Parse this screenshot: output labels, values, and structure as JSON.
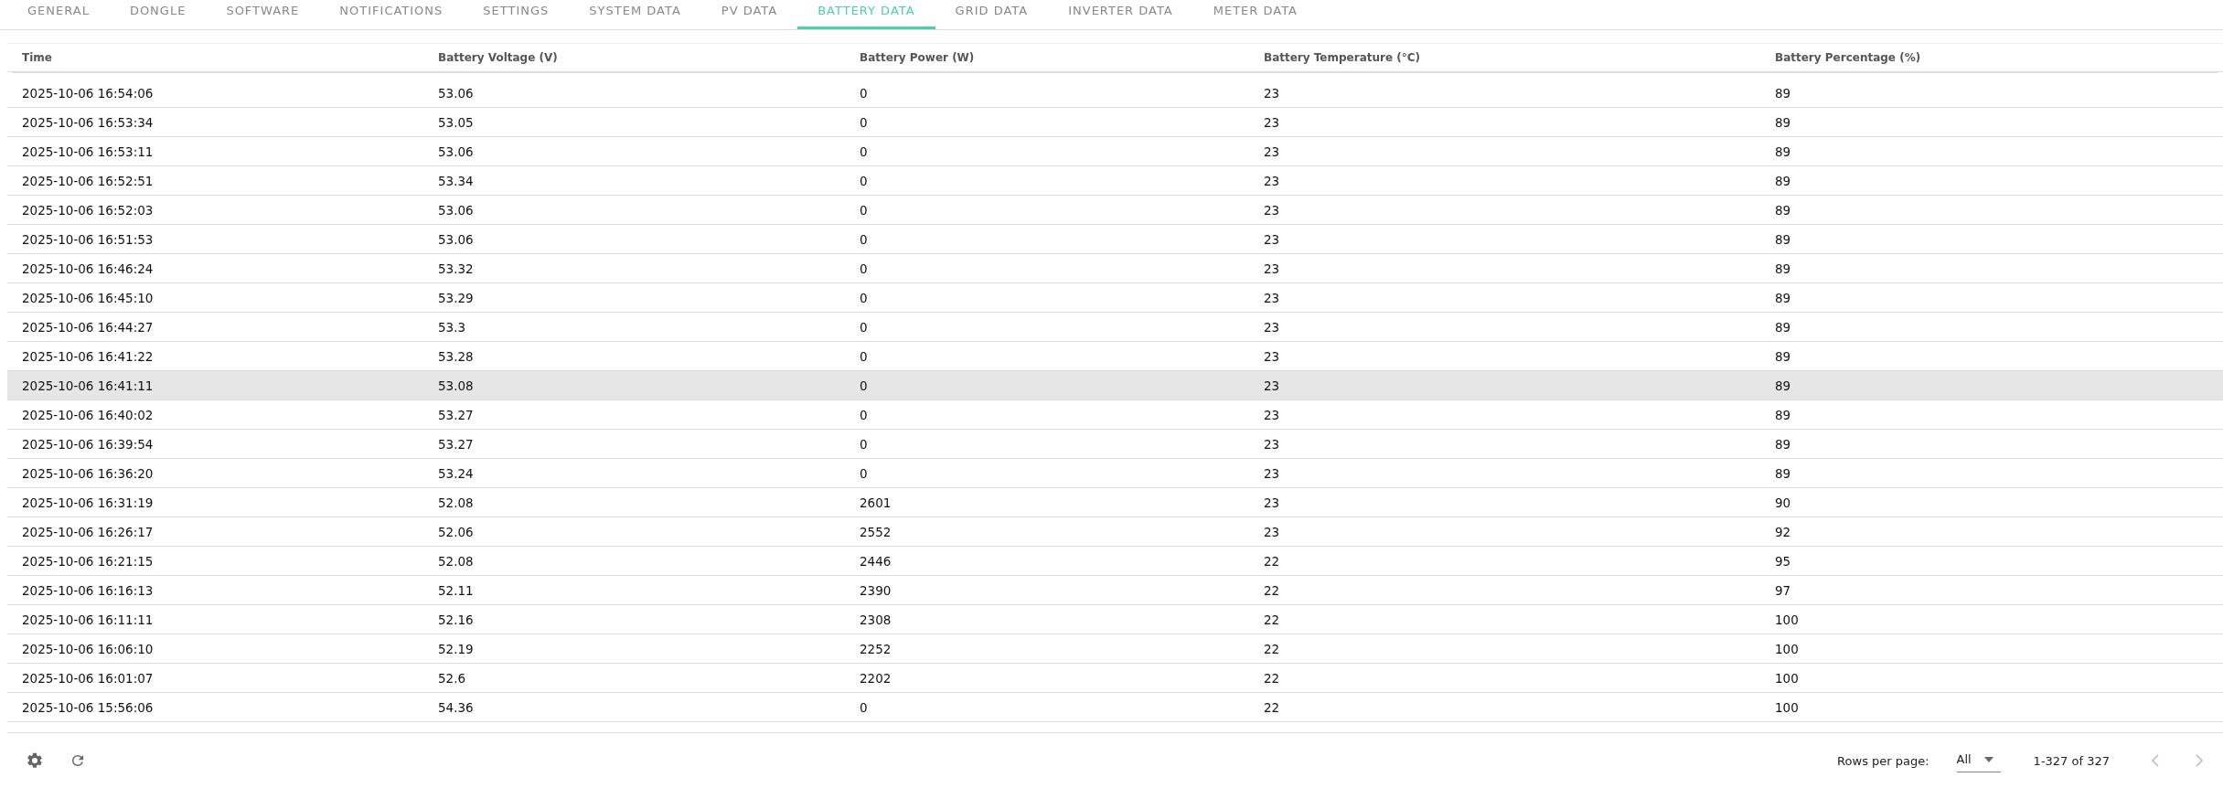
{
  "tabs": [
    {
      "label": "GENERAL",
      "selected": false
    },
    {
      "label": "DONGLE",
      "selected": false
    },
    {
      "label": "SOFTWARE",
      "selected": false
    },
    {
      "label": "NOTIFICATIONS",
      "selected": false
    },
    {
      "label": "SETTINGS",
      "selected": false
    },
    {
      "label": "SYSTEM DATA",
      "selected": false
    },
    {
      "label": "PV DATA",
      "selected": false
    },
    {
      "label": "BATTERY DATA",
      "selected": true
    },
    {
      "label": "GRID DATA",
      "selected": false
    },
    {
      "label": "INVERTER DATA",
      "selected": false
    },
    {
      "label": "METER DATA",
      "selected": false
    }
  ],
  "table": {
    "columns": [
      "Time",
      "Battery Voltage (V)",
      "Battery Power (W)",
      "Battery Temperature (°C)",
      "Battery Percentage (%)"
    ],
    "rows": [
      {
        "cells": [
          "2025-10-06 16:54:06",
          "53.06",
          "0",
          "23",
          "89"
        ],
        "selected": false
      },
      {
        "cells": [
          "2025-10-06 16:53:34",
          "53.05",
          "0",
          "23",
          "89"
        ],
        "selected": false
      },
      {
        "cells": [
          "2025-10-06 16:53:11",
          "53.06",
          "0",
          "23",
          "89"
        ],
        "selected": false
      },
      {
        "cells": [
          "2025-10-06 16:52:51",
          "53.34",
          "0",
          "23",
          "89"
        ],
        "selected": false
      },
      {
        "cells": [
          "2025-10-06 16:52:03",
          "53.06",
          "0",
          "23",
          "89"
        ],
        "selected": false
      },
      {
        "cells": [
          "2025-10-06 16:51:53",
          "53.06",
          "0",
          "23",
          "89"
        ],
        "selected": false
      },
      {
        "cells": [
          "2025-10-06 16:46:24",
          "53.32",
          "0",
          "23",
          "89"
        ],
        "selected": false
      },
      {
        "cells": [
          "2025-10-06 16:45:10",
          "53.29",
          "0",
          "23",
          "89"
        ],
        "selected": false
      },
      {
        "cells": [
          "2025-10-06 16:44:27",
          "53.3",
          "0",
          "23",
          "89"
        ],
        "selected": false
      },
      {
        "cells": [
          "2025-10-06 16:41:22",
          "53.28",
          "0",
          "23",
          "89"
        ],
        "selected": false
      },
      {
        "cells": [
          "2025-10-06 16:41:11",
          "53.08",
          "0",
          "23",
          "89"
        ],
        "selected": true
      },
      {
        "cells": [
          "2025-10-06 16:40:02",
          "53.27",
          "0",
          "23",
          "89"
        ],
        "selected": false
      },
      {
        "cells": [
          "2025-10-06 16:39:54",
          "53.27",
          "0",
          "23",
          "89"
        ],
        "selected": false
      },
      {
        "cells": [
          "2025-10-06 16:36:20",
          "53.24",
          "0",
          "23",
          "89"
        ],
        "selected": false
      },
      {
        "cells": [
          "2025-10-06 16:31:19",
          "52.08",
          "2601",
          "23",
          "90"
        ],
        "selected": false
      },
      {
        "cells": [
          "2025-10-06 16:26:17",
          "52.06",
          "2552",
          "23",
          "92"
        ],
        "selected": false
      },
      {
        "cells": [
          "2025-10-06 16:21:15",
          "52.08",
          "2446",
          "22",
          "95"
        ],
        "selected": false
      },
      {
        "cells": [
          "2025-10-06 16:16:13",
          "52.11",
          "2390",
          "22",
          "97"
        ],
        "selected": false
      },
      {
        "cells": [
          "2025-10-06 16:11:11",
          "52.16",
          "2308",
          "22",
          "100"
        ],
        "selected": false
      },
      {
        "cells": [
          "2025-10-06 16:06:10",
          "52.19",
          "2252",
          "22",
          "100"
        ],
        "selected": false
      },
      {
        "cells": [
          "2025-10-06 16:01:07",
          "52.6",
          "2202",
          "22",
          "100"
        ],
        "selected": false
      },
      {
        "cells": [
          "2025-10-06 15:56:06",
          "54.36",
          "0",
          "22",
          "100"
        ],
        "selected": false
      }
    ]
  },
  "pagination": {
    "rows_per_page_label": "Rows per page:",
    "rows_per_page": "All",
    "range": "1-327 of 327"
  }
}
